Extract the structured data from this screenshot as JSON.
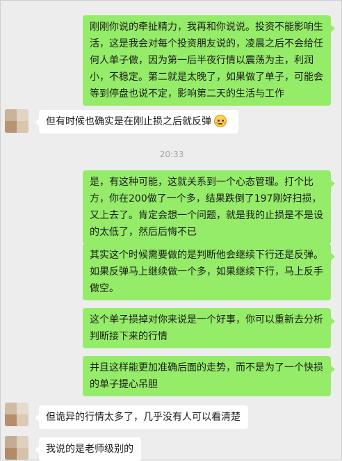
{
  "messages": [
    {
      "side": "out",
      "text": "刚刚你说的牵扯精力，我再和你说说。投资不能影响生活，这是我会对每个投资朋友说的，凌晨之后不会给任何人单子做，因为第一后半夜行情以震荡为主，利润小，不稳定。第二就是太晚了，如果做了单子，可能会等到停盘也说不定，影响第二天的生活与工作"
    },
    {
      "side": "in",
      "text": "但有时候也确实是在刚止损之后就反弹",
      "emoji": "flushed-face-emoji"
    },
    {
      "side": "out",
      "text": "是，有这种可能，这就关系到一个心态管理。打个比方，你在200做了一个多，结果跌倒了197刚好扫损，又上去了。肯定会想一个问题，就是我的止损是不是设的太低了，然后后悔不已"
    },
    {
      "side": "out",
      "text": "其实这个时候需要做的是判断他会继续下行还是反弹。如果反弹马上继续做一个多，如果继续下行，马上反手做空。"
    },
    {
      "side": "out",
      "text": "这个单子损掉对你来说是一个好事，你可以重新去分析判断接下来的行情"
    },
    {
      "side": "out",
      "text": "并且这样能更加准确后面的走势，而不是为了一个快损的单子提心吊胆"
    },
    {
      "side": "in",
      "text": "但诡异的行情太多了，几乎没有人可以看清楚"
    },
    {
      "side": "in",
      "text": "我说的是老师级别的"
    }
  ],
  "timestamp": "20:33",
  "colors": {
    "outgoing_bubble": "#95ec69",
    "incoming_bubble": "#ffffff",
    "background": "#ededed"
  }
}
